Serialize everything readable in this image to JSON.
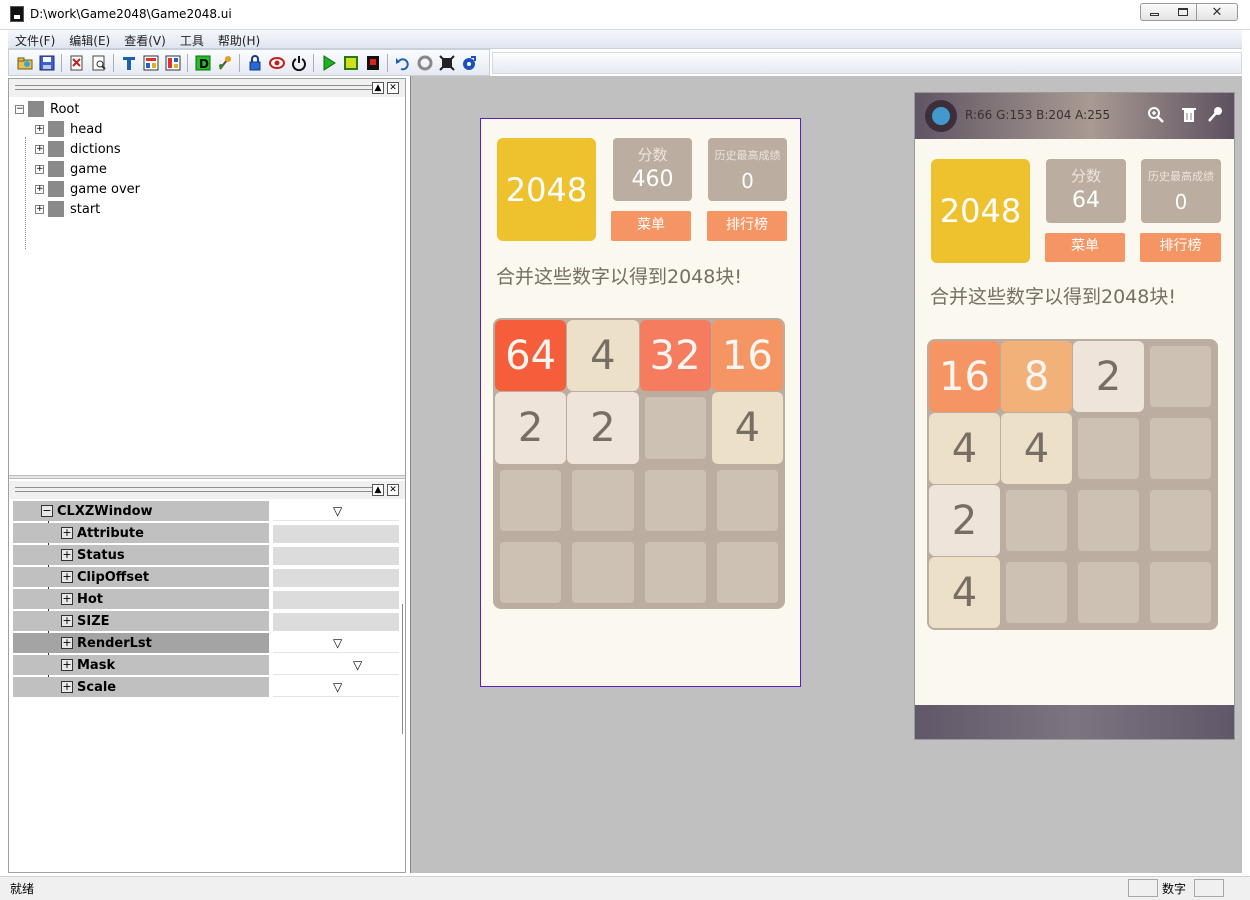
{
  "window": {
    "title": "D:\\work\\Game2048\\Game2048.ui",
    "min_glyph": "",
    "max_glyph": "",
    "close_glyph": "✕"
  },
  "menu": [
    "文件(F)",
    "编辑(E)",
    "查看(V)",
    "工具",
    "帮助(H)"
  ],
  "tree": {
    "root": "Root",
    "children": [
      "head",
      "dictions",
      "game",
      "game over",
      "start"
    ]
  },
  "properties": {
    "root": "CLXZWindow",
    "rows": [
      "Attribute",
      "Status",
      "ClipOffset",
      "Hot",
      "SIZE",
      "RenderLst",
      "Mask",
      "Scale"
    ],
    "dropdown_glyph": "▽"
  },
  "game1": {
    "logo": "2048",
    "score_label": "分数",
    "score": "460",
    "best_label": "历史最高成绩",
    "best": "0",
    "menu_button": "菜单",
    "rank_button": "排行榜",
    "subtitle": "合并这些数字以得到2048块!",
    "grid": [
      [
        "64",
        "4",
        "32",
        "16"
      ],
      [
        "2",
        "2",
        "",
        "4"
      ],
      [
        "",
        "",
        "",
        ""
      ],
      [
        "",
        "",
        "",
        ""
      ]
    ]
  },
  "game2": {
    "color_readout": "R:66 G:153 B:204 A:255",
    "logo": "2048",
    "score_label": "分数",
    "score": "64",
    "best_label": "历史最高成绩",
    "best": "0",
    "menu_button": "菜单",
    "rank_button": "排行榜",
    "subtitle": "合并这些数字以得到2048块!",
    "grid": [
      [
        "16",
        "8",
        "2",
        ""
      ],
      [
        "4",
        "4",
        "",
        ""
      ],
      [
        "2",
        "",
        "",
        ""
      ],
      [
        "4",
        "",
        "",
        ""
      ]
    ]
  },
  "status": {
    "text": "就绪",
    "indicator": "数字"
  },
  "colors": {
    "logo": "#edc22e",
    "board": "#bbada0",
    "button": "#f59563",
    "selection_border": "#5a1fbf"
  }
}
